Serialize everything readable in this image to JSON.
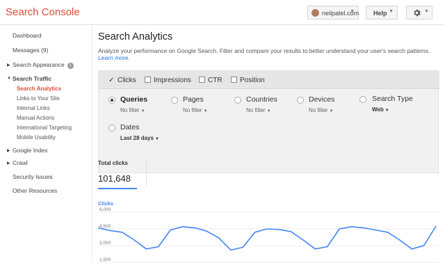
{
  "header": {
    "brand": "Search Console",
    "account": "neilpatel.com",
    "help_label": "Help"
  },
  "sidebar": {
    "items": [
      {
        "label": "Dashboard"
      },
      {
        "label": "Messages (9)"
      },
      {
        "label": "Search Appearance"
      },
      {
        "label": "Search Traffic"
      },
      {
        "label": "Search Analytics"
      },
      {
        "label": "Links to Your Site"
      },
      {
        "label": "Internal Links"
      },
      {
        "label": "Manual Actions"
      },
      {
        "label": "International Targeting"
      },
      {
        "label": "Mobile Usability"
      },
      {
        "label": "Google Index"
      },
      {
        "label": "Crawl"
      },
      {
        "label": "Security Issues"
      },
      {
        "label": "Other Resources"
      }
    ],
    "info_glyph": "i"
  },
  "main": {
    "title": "Search Analytics",
    "description": "Analyze your performance on Google Search. Filter and compare your results to better understand your user's search patterns.",
    "learn_more": "Learn more."
  },
  "metrics": [
    {
      "label": "Clicks",
      "checked": true
    },
    {
      "label": "Impressions",
      "checked": false
    },
    {
      "label": "CTR",
      "checked": false
    },
    {
      "label": "Position",
      "checked": false
    }
  ],
  "dimensions": [
    {
      "label": "Queries",
      "value": "No filter",
      "selected": true
    },
    {
      "label": "Pages",
      "value": "No filter",
      "selected": false
    },
    {
      "label": "Countries",
      "value": "No filter",
      "selected": false
    },
    {
      "label": "Devices",
      "value": "No filter",
      "selected": false
    },
    {
      "label": "Search Type",
      "value": "Web",
      "selected": false
    },
    {
      "label": "Dates",
      "value": "Last 28 days",
      "selected": false
    }
  ],
  "totals": {
    "label": "Total clicks",
    "value": "101,648"
  },
  "chart_data": {
    "type": "line",
    "title": "Clicks",
    "ylim": [
      1500,
      6000
    ],
    "yticks": [
      "6,000",
      "4,500",
      "3,000",
      "1,500"
    ],
    "ytick_values": [
      6000,
      4500,
      3000,
      1500
    ],
    "series": [
      {
        "values": [
          4600,
          4350,
          4200,
          3500,
          2700,
          2900,
          4400,
          4700,
          4600,
          4300,
          3700,
          2600,
          2850,
          4200,
          4500,
          4450,
          4250,
          3500,
          2700,
          2900,
          4500,
          4700,
          4600,
          4400,
          4200,
          3500,
          2700,
          3000,
          4750
        ]
      }
    ],
    "color": "#4285f4",
    "grid": true
  }
}
